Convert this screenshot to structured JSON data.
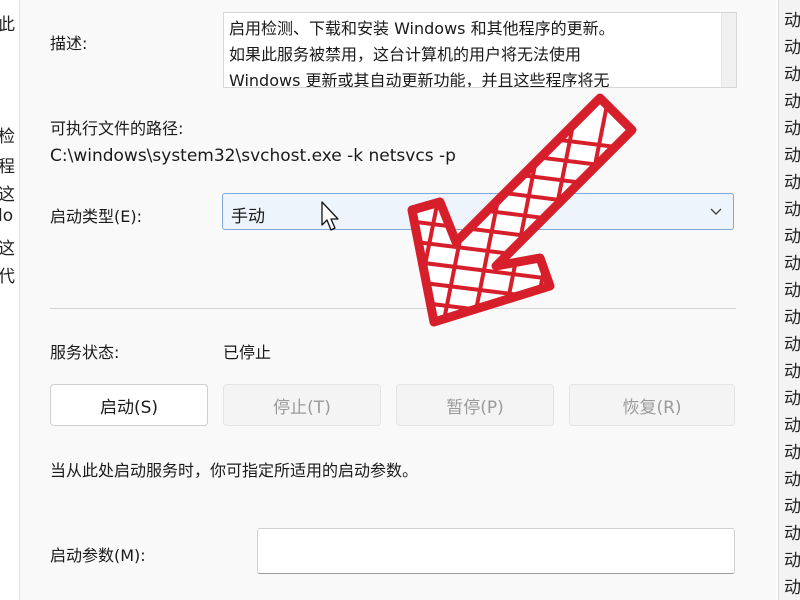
{
  "left_strip": [
    "此",
    "检",
    "程",
    "这",
    "lo",
    "这",
    "代"
  ],
  "right_strip": [
    "动",
    "动",
    "动",
    "动",
    "动",
    "动",
    "动",
    "动",
    "动",
    "动",
    "动",
    "动",
    "动",
    "动",
    "动",
    "动",
    "动",
    "动",
    "动",
    "动",
    "动",
    "动"
  ],
  "description": {
    "label": "描述:",
    "line1": "启用检测、下载和安装 Windows 和其他程序的更新。",
    "line2": "如果此服务被禁用，这台计算机的用户将无法使用",
    "line3": "Windows 更新或其自动更新功能，并且这些程序将无"
  },
  "executable": {
    "label": "可执行文件的路径:",
    "path": "C:\\windows\\system32\\svchost.exe -k netsvcs -p"
  },
  "startup_type": {
    "label": "启动类型(E):",
    "value": "手动"
  },
  "service_status": {
    "label": "服务状态:",
    "value": "已停止"
  },
  "buttons": {
    "start": "启动(S)",
    "stop": "停止(T)",
    "pause": "暂停(P)",
    "resume": "恢复(R)"
  },
  "hint": "当从此处启动服务时，你可指定所适用的启动参数。",
  "start_params": {
    "label": "启动参数(M):",
    "value": ""
  },
  "colors": {
    "arrow": "#d61f2a",
    "accent_border": "#7fa8d6"
  },
  "icons": [
    "chevron-down-icon",
    "mouse-cursor-icon",
    "red-arrow-annotation-icon"
  ]
}
